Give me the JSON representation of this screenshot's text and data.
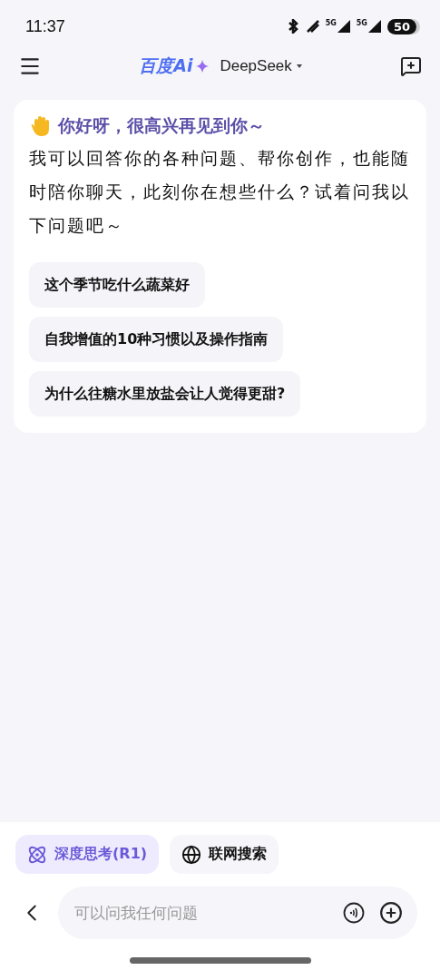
{
  "status_bar": {
    "time": "11:37",
    "signal_labels": [
      "5G",
      "5G"
    ],
    "battery": "50"
  },
  "header": {
    "logo": "百度Ai",
    "model": "DeepSeek"
  },
  "welcome": {
    "greeting": "你好呀，很高兴再见到你～",
    "message": "我可以回答你的各种问题、帮你创作，也能随时陪你聊天，此刻你在想些什么？试着问我以下问题吧～",
    "suggestions": [
      "这个季节吃什么蔬菜好",
      "自我增值的10种习惯以及操作指南",
      "为什么往糖水里放盐会让人觉得更甜?"
    ]
  },
  "toggles": [
    {
      "kind": "think",
      "label": "深度思考(R1)",
      "selected": true
    },
    {
      "kind": "web",
      "label": "联网搜索",
      "selected": false
    }
  ],
  "input": {
    "placeholder": "可以问我任何问题"
  }
}
